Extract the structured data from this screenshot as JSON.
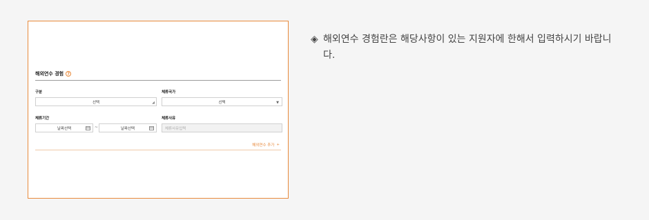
{
  "form": {
    "section_title": "해외연수 경험",
    "help_icon": "?",
    "division": {
      "label": "구분",
      "value": "선택"
    },
    "country": {
      "label": "체류국가",
      "value": "선택"
    },
    "period": {
      "label": "체류기간",
      "start_value": "날짜선택",
      "separator": "~",
      "end_value": "날짜선택"
    },
    "reason": {
      "label": "체류사유",
      "placeholder": "체류사유입력"
    },
    "add_button": {
      "label": "해외연수 추가",
      "icon": "+"
    }
  },
  "note": {
    "bullet": "◈",
    "text": "해외연수 경험란은 해당사항이 있는 지원자에 한해서 입력하시기 바랍니다."
  },
  "colors": {
    "accent": "#e8893a"
  }
}
